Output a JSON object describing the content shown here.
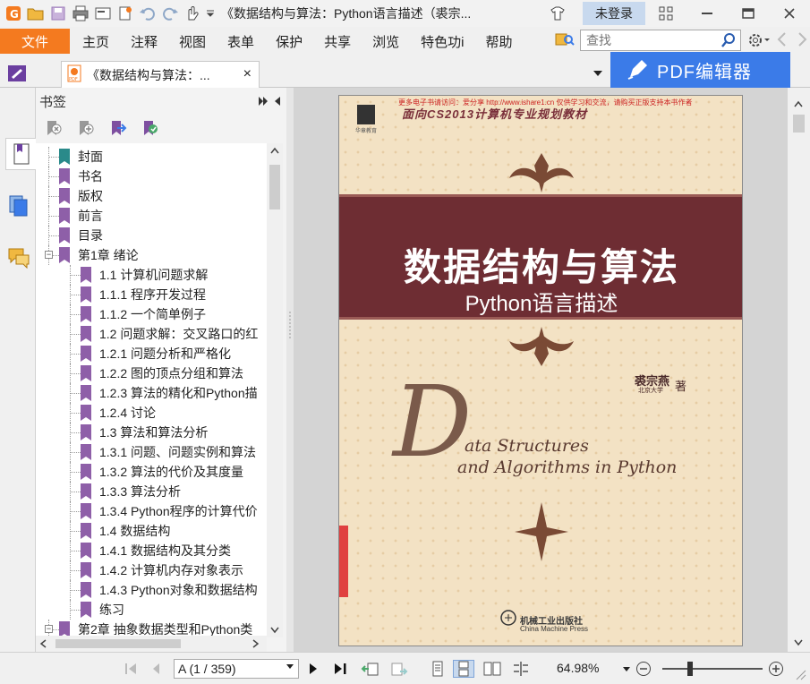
{
  "window": {
    "title": "《数据结构与算法：Python语言描述（裘宗...",
    "login_label": "未登录"
  },
  "menu": {
    "file": "文件",
    "items": [
      "主页",
      "注释",
      "视图",
      "表单",
      "保护",
      "共享",
      "浏览",
      "特色功i",
      "帮助"
    ],
    "search_placeholder": "查找"
  },
  "tab": {
    "label": "《数据结构与算法：...",
    "close": "×"
  },
  "pdf_editor_label": "PDF编辑器",
  "bookmarks": {
    "title": "书签",
    "items": [
      {
        "label": "封面",
        "level": 0
      },
      {
        "label": "书名",
        "level": 0
      },
      {
        "label": "版权",
        "level": 0
      },
      {
        "label": "前言",
        "level": 0
      },
      {
        "label": "目录",
        "level": 0
      },
      {
        "label": "第1章 绪论",
        "level": 0
      },
      {
        "label": "1.1 计算机问题求解",
        "level": 1
      },
      {
        "label": "1.1.1 程序开发过程",
        "level": 1
      },
      {
        "label": "1.1.2 一个简单例子",
        "level": 1
      },
      {
        "label": "1.2 问题求解：交叉路口的红",
        "level": 1
      },
      {
        "label": "1.2.1 问题分析和严格化",
        "level": 1
      },
      {
        "label": "1.2.2 图的顶点分组和算法",
        "level": 1
      },
      {
        "label": "1.2.3 算法的精化和Python描",
        "level": 1
      },
      {
        "label": "1.2.4 讨论",
        "level": 1
      },
      {
        "label": "1.3 算法和算法分析",
        "level": 1
      },
      {
        "label": "1.3.1 问题、问题实例和算法",
        "level": 1
      },
      {
        "label": "1.3.2 算法的代价及其度量",
        "level": 1
      },
      {
        "label": "1.3.3 算法分析",
        "level": 1
      },
      {
        "label": "1.3.4 Python程序的计算代价",
        "level": 1
      },
      {
        "label": "1.4 数据结构",
        "level": 1
      },
      {
        "label": "1.4.1 数据结构及其分类",
        "level": 1
      },
      {
        "label": "1.4.2 计算机内存对象表示",
        "level": 1
      },
      {
        "label": "1.4.3 Python对象和数据结构",
        "level": 1
      },
      {
        "label": "练习",
        "level": 1
      },
      {
        "label": "第2章 抽象数据类型和Python类",
        "level": 0
      }
    ]
  },
  "cover": {
    "top_note": "更多电子书请访问：爱分享 http://www.ishare1.cn  仅供学习和交流，请购买正版支持本书作者",
    "series": "面向CS2013计算机专业规划教材",
    "logo_text": "华章教育",
    "title": "数据结构与算法",
    "subtitle": "Python语言描述",
    "author": "裘宗燕",
    "author_suffix": "著",
    "affiliation": "北京大学",
    "big_letter": "D",
    "en_line1": "ata Structures",
    "en_line2": "and Algorithms in Python",
    "publisher": "机械工业出版社",
    "publisher_en": "China Machine Press"
  },
  "status": {
    "page_field": "A (1 / 359)",
    "zoom": "64.98%"
  },
  "colors": {
    "accent_orange": "#f47a1f",
    "pdf_editor_blue": "#3b7be8",
    "bookmark_purple": "#8e5fa8",
    "bookmark_teal": "#2a8a8a",
    "cover_banner": "#6e2d33"
  }
}
